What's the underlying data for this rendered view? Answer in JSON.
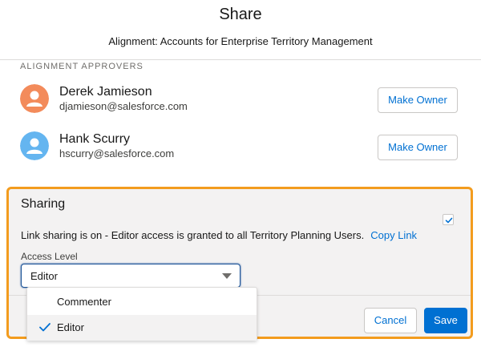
{
  "header": {
    "title": "Share",
    "subtitle": "Alignment: Accounts for Enterprise Territory Management"
  },
  "approvers": {
    "section_label": "ALIGNMENT APPROVERS",
    "items": [
      {
        "name": "Derek Jamieson",
        "email": "djamieson@salesforce.com",
        "button": "Make Owner",
        "avatar_color": "#f38b5b"
      },
      {
        "name": "Hank Scurry",
        "email": "hscurry@salesforce.com",
        "button": "Make Owner",
        "avatar_color": "#64b5f0"
      }
    ]
  },
  "sharing": {
    "title": "Sharing",
    "checked": true,
    "link_text": "Link sharing is on - Editor access is granted to all Territory Planning Users.",
    "copy_link": "Copy Link",
    "access_label": "Access Level",
    "access_value": "Editor",
    "highlight_color": "#f39c1e"
  },
  "dropdown": {
    "options": [
      {
        "label": "Commenter",
        "selected": false
      },
      {
        "label": "Editor",
        "selected": true
      }
    ]
  },
  "footer": {
    "cancel": "Cancel",
    "save": "Save",
    "accent_color": "#0070d2"
  }
}
